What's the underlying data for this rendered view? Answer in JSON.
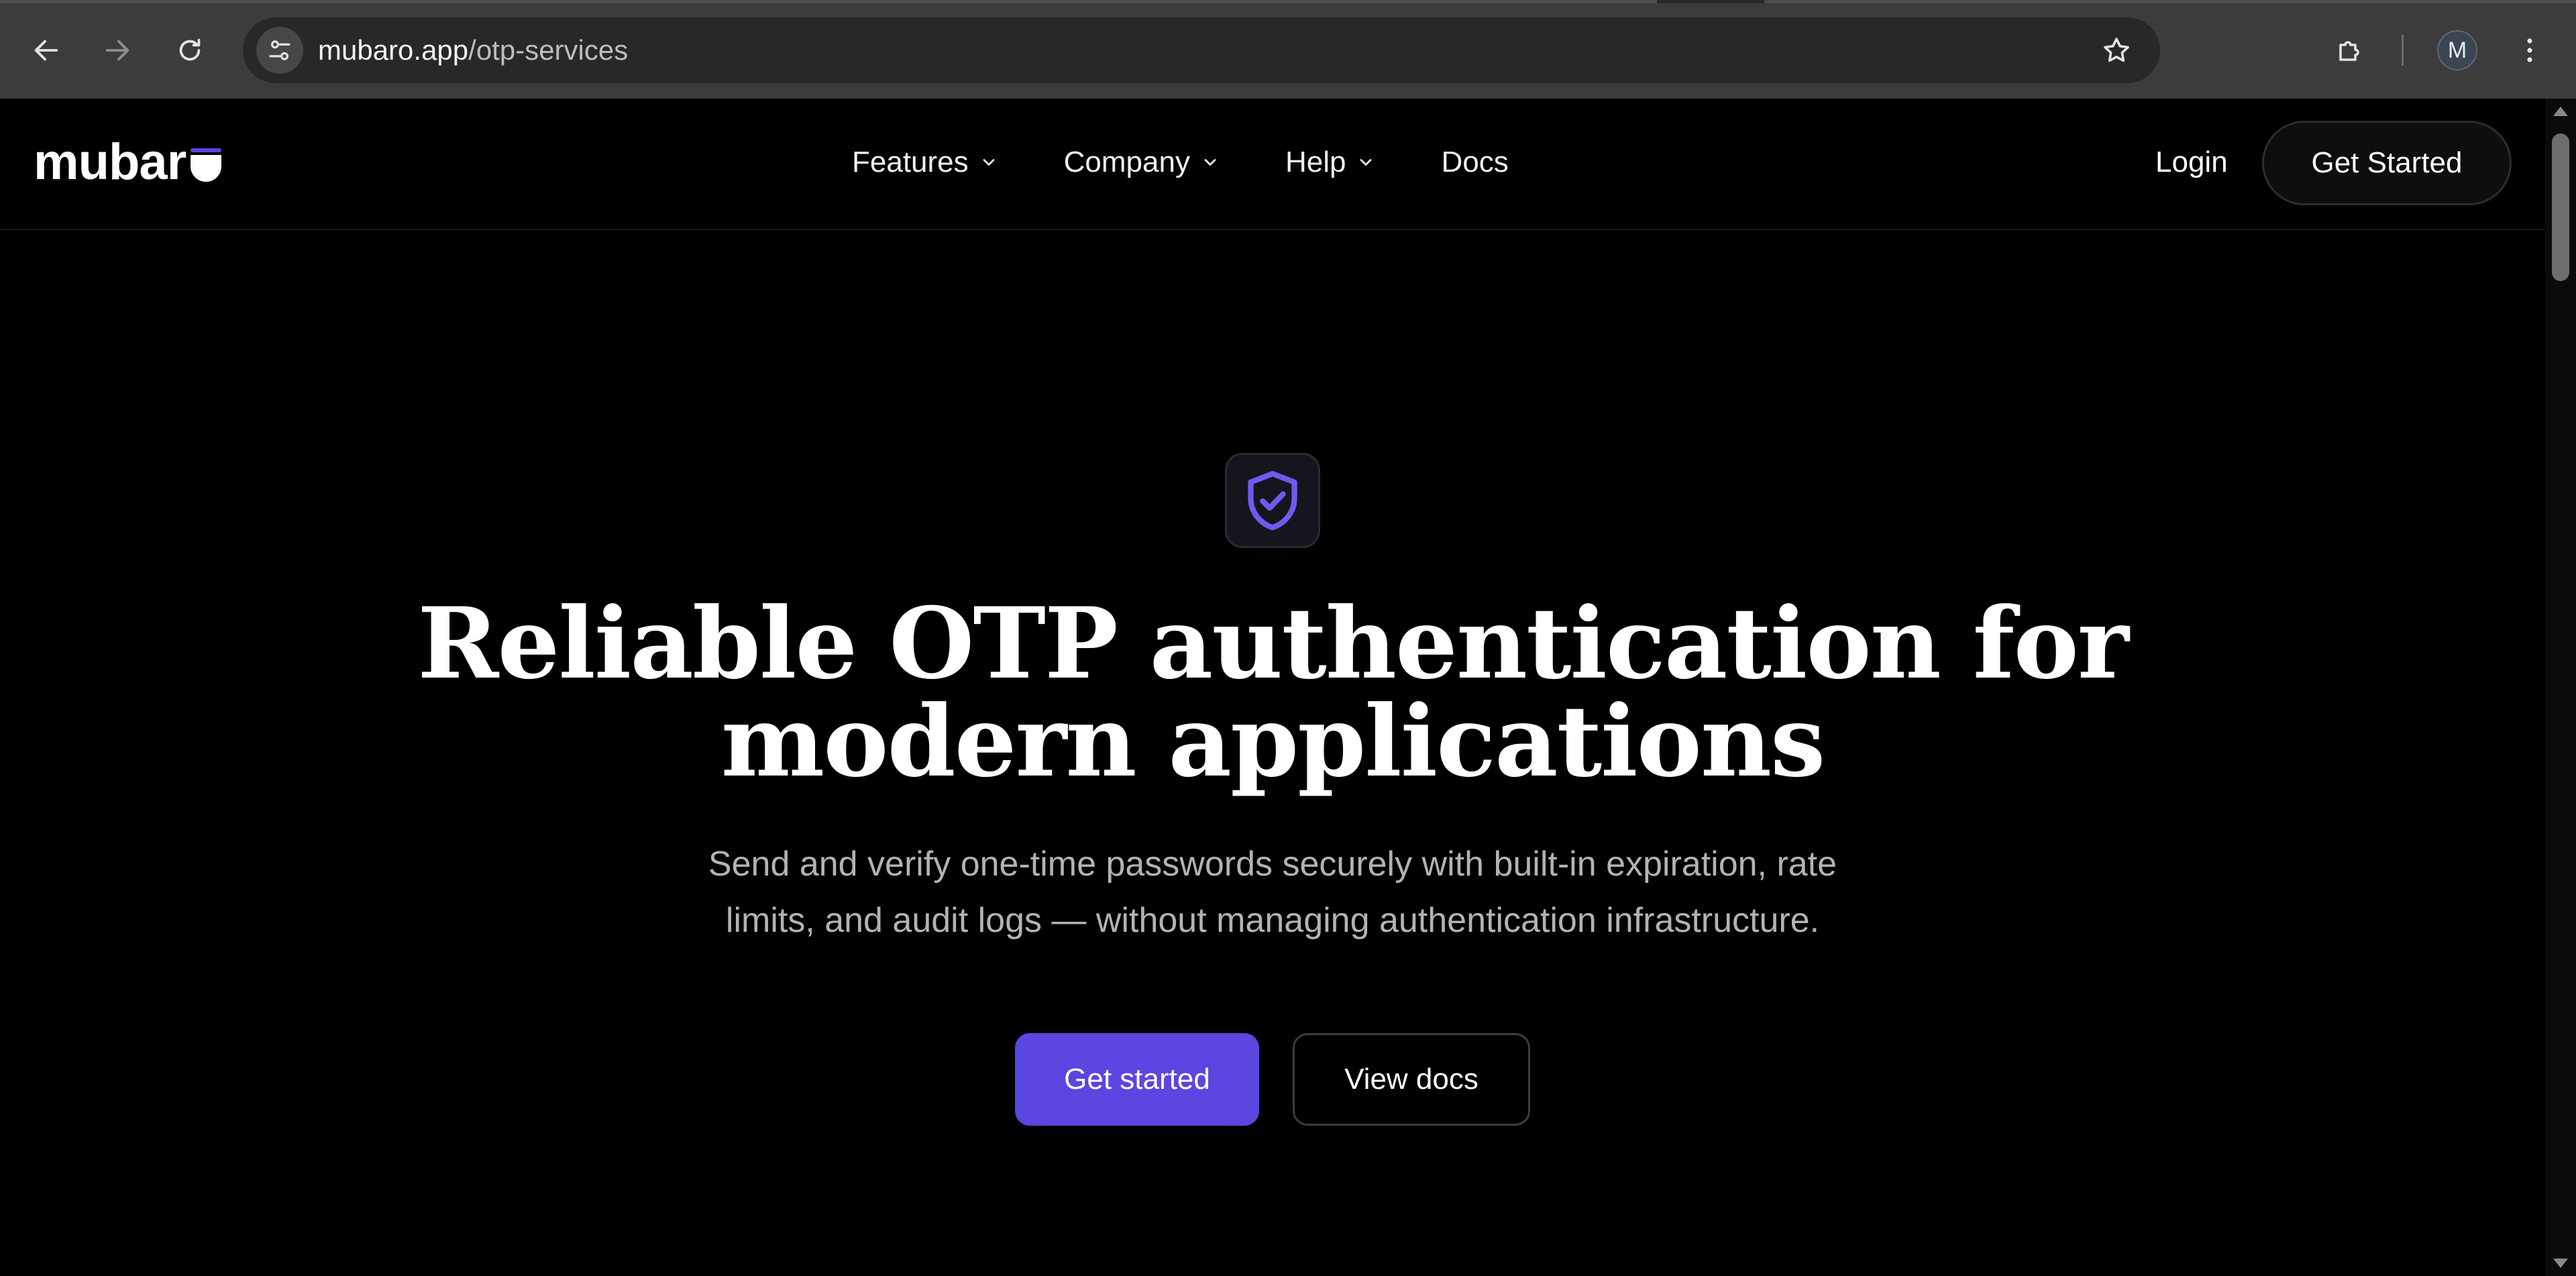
{
  "browser": {
    "url_host": "mubaro.app",
    "url_path": "/otp-services",
    "profile_initial": "M"
  },
  "site": {
    "logo_text": "mubar",
    "nav": [
      {
        "label": "Features",
        "has_dropdown": true
      },
      {
        "label": "Company",
        "has_dropdown": true
      },
      {
        "label": "Help",
        "has_dropdown": true
      },
      {
        "label": "Docs",
        "has_dropdown": false
      }
    ],
    "login_label": "Login",
    "get_started_label": "Get Started"
  },
  "hero": {
    "icon": "shield-check-icon",
    "title_line1": "Reliable OTP authentication for",
    "title_line2": "modern applications",
    "subtitle_line1": "Send and verify one-time passwords securely with built-in expiration, rate",
    "subtitle_line2": "limits, and audit logs — without managing authentication infrastructure.",
    "primary_cta": "Get started",
    "secondary_cta": "View docs"
  },
  "colors": {
    "accent": "#5a46e0",
    "background": "#000000",
    "chrome": "#3c3c3c"
  }
}
